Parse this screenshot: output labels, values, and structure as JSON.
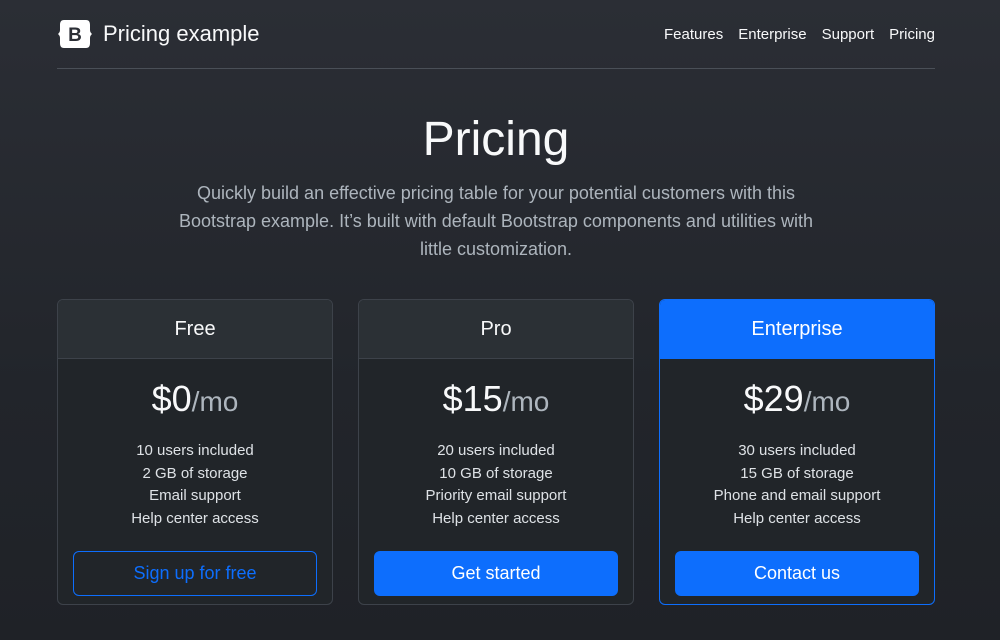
{
  "header": {
    "brand": "Pricing example",
    "logo_letter": "B",
    "nav": [
      "Features",
      "Enterprise",
      "Support",
      "Pricing"
    ]
  },
  "hero": {
    "title": "Pricing",
    "lead": "Quickly build an effective pricing table for your potential customers with this Bootstrap example. It’s built with default Bootstrap components and utilities with little customization."
  },
  "plans": [
    {
      "name": "Free",
      "price": "$0",
      "per": "/mo",
      "features": [
        "10 users included",
        "2 GB of storage",
        "Email support",
        "Help center access"
      ],
      "cta": "Sign up for free"
    },
    {
      "name": "Pro",
      "price": "$15",
      "per": "/mo",
      "features": [
        "20 users included",
        "10 GB of storage",
        "Priority email support",
        "Help center access"
      ],
      "cta": "Get started"
    },
    {
      "name": "Enterprise",
      "price": "$29",
      "per": "/mo",
      "features": [
        "30 users included",
        "15 GB of storage",
        "Phone and email support",
        "Help center access"
      ],
      "cta": "Contact us"
    }
  ],
  "colors": {
    "accent": "#0d6efd",
    "background": "#212529"
  }
}
